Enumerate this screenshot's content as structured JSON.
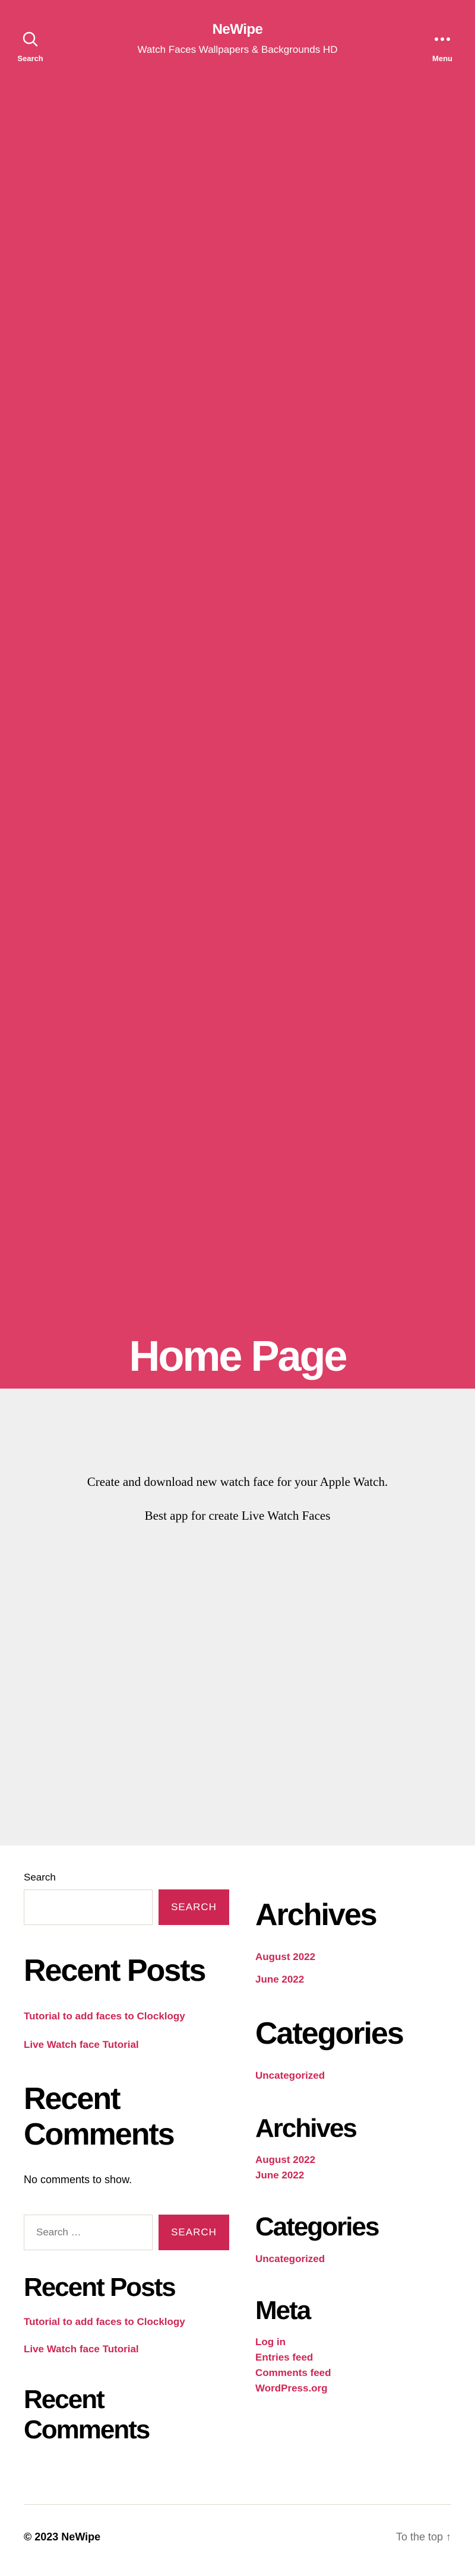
{
  "header": {
    "search_label": "Search",
    "menu_label": "Menu",
    "site_title": "NeWipe",
    "site_description": "Watch Faces Wallpapers & Backgrounds HD",
    "accent_color": "#dc3e66"
  },
  "hero": {
    "page_title": "Home Page",
    "scroll_icon": "arrow-down-icon"
  },
  "content": {
    "paragraph_1": "Create and download new watch face for your Apple Watch.",
    "paragraph_2": "Best app for create Live Watch Faces"
  },
  "widgets": {
    "search_1": {
      "label": "Search",
      "button": "SEARCH"
    },
    "recent_posts_1": {
      "title": "Recent Posts",
      "items": [
        "Tutorial to add faces to Clocklogy",
        "Live Watch face Tutorial"
      ]
    },
    "recent_comments_1": {
      "title": "Recent Comments",
      "empty_text": "No comments to show."
    },
    "search_2": {
      "placeholder": "Search …",
      "button": "SEARCH"
    },
    "recent_posts_2": {
      "title": "Recent Posts",
      "items": [
        "Tutorial to add faces to Clocklogy",
        "Live Watch face Tutorial"
      ]
    },
    "recent_comments_2": {
      "title": "Recent Comments"
    },
    "archives_1": {
      "title": "Archives",
      "items": [
        "August 2022",
        "June 2022"
      ]
    },
    "categories_1": {
      "title": "Categories",
      "items": [
        "Uncategorized"
      ]
    },
    "archives_2": {
      "title": "Archives",
      "items": [
        "August 2022",
        "June 2022"
      ]
    },
    "categories_2": {
      "title": "Categories",
      "items": [
        "Uncategorized"
      ]
    },
    "meta": {
      "title": "Meta",
      "items": [
        "Log in",
        "Entries feed",
        "Comments feed",
        "WordPress.org"
      ]
    },
    "link_color": "#cd2653"
  },
  "footer": {
    "copyright": "© 2023 NeWipe",
    "to_top": "To the top ↑"
  }
}
